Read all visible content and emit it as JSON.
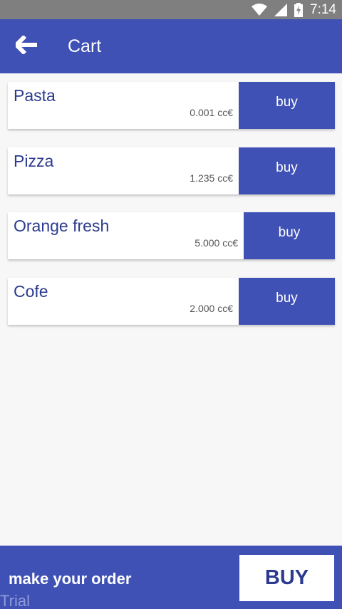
{
  "status_bar": {
    "time": "7:14",
    "icons": [
      "wifi-icon",
      "signal-icon",
      "battery-icon"
    ]
  },
  "app_bar": {
    "title": "Cart",
    "back_icon": "arrow-back-icon"
  },
  "cart": {
    "items": [
      {
        "name": "Pasta",
        "price": "0.001 cc€",
        "buy_label": "buy"
      },
      {
        "name": "Pizza",
        "price": "1.235 cc€",
        "buy_label": "buy"
      },
      {
        "name": "Orange fresh",
        "price": "5.000 cc€",
        "buy_label": "buy"
      },
      {
        "name": "Cofe",
        "price": "2.000 cc€",
        "buy_label": "buy"
      }
    ]
  },
  "footer": {
    "order_text": "make your order",
    "buy_label": "BUY",
    "watermark": "Trial"
  },
  "colors": {
    "primary": "#3f51b5",
    "status_bar": "#7f7f7f",
    "background": "#f7f7f7",
    "item_text": "#2c3a8f"
  }
}
